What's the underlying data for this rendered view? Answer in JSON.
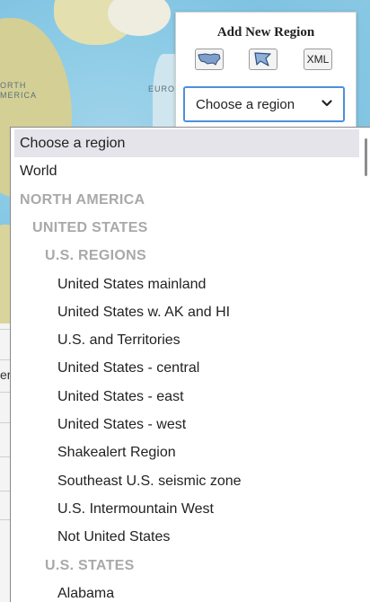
{
  "map": {
    "labels": {
      "north": "ORTH",
      "america": "MERICA",
      "europe": "EUROP"
    }
  },
  "page_fragment": {
    "text": "er"
  },
  "panel": {
    "title": "Add New Region",
    "buttons": {
      "us_shape_icon": "us-map-icon",
      "polygon_icon": "polygon-icon",
      "xml_label": "XML"
    },
    "select": {
      "value": "Choose a region",
      "chevron_icon": "chevron-down-icon"
    }
  },
  "dropdown": {
    "options": [
      {
        "label": "Choose a region",
        "kind": "option",
        "level": 0,
        "selected": true
      },
      {
        "label": "World",
        "kind": "option",
        "level": 0
      },
      {
        "label": "NORTH AMERICA",
        "kind": "group",
        "level": 0
      },
      {
        "label": "UNITED STATES",
        "kind": "group",
        "level": 1
      },
      {
        "label": "U.S. REGIONS",
        "kind": "group",
        "level": 2
      },
      {
        "label": "United States mainland",
        "kind": "option",
        "level": 3
      },
      {
        "label": "United States w. AK and HI",
        "kind": "option",
        "level": 3
      },
      {
        "label": "U.S. and Territories",
        "kind": "option",
        "level": 3
      },
      {
        "label": "United States - central",
        "kind": "option",
        "level": 3
      },
      {
        "label": "United States - east",
        "kind": "option",
        "level": 3
      },
      {
        "label": "United States - west",
        "kind": "option",
        "level": 3
      },
      {
        "label": "Shakealert Region",
        "kind": "option",
        "level": 3
      },
      {
        "label": "Southeast U.S. seismic zone",
        "kind": "option",
        "level": 3
      },
      {
        "label": "U.S. Intermountain West",
        "kind": "option",
        "level": 3
      },
      {
        "label": "Not United States",
        "kind": "option",
        "level": 3
      },
      {
        "label": "U.S. STATES",
        "kind": "group",
        "level": 2
      },
      {
        "label": "Alabama",
        "kind": "option",
        "level": 3
      }
    ]
  },
  "colors": {
    "focus_border": "#4c90d8",
    "group_text": "#a9a9a9",
    "selected_bg": "#e4e4ea"
  }
}
